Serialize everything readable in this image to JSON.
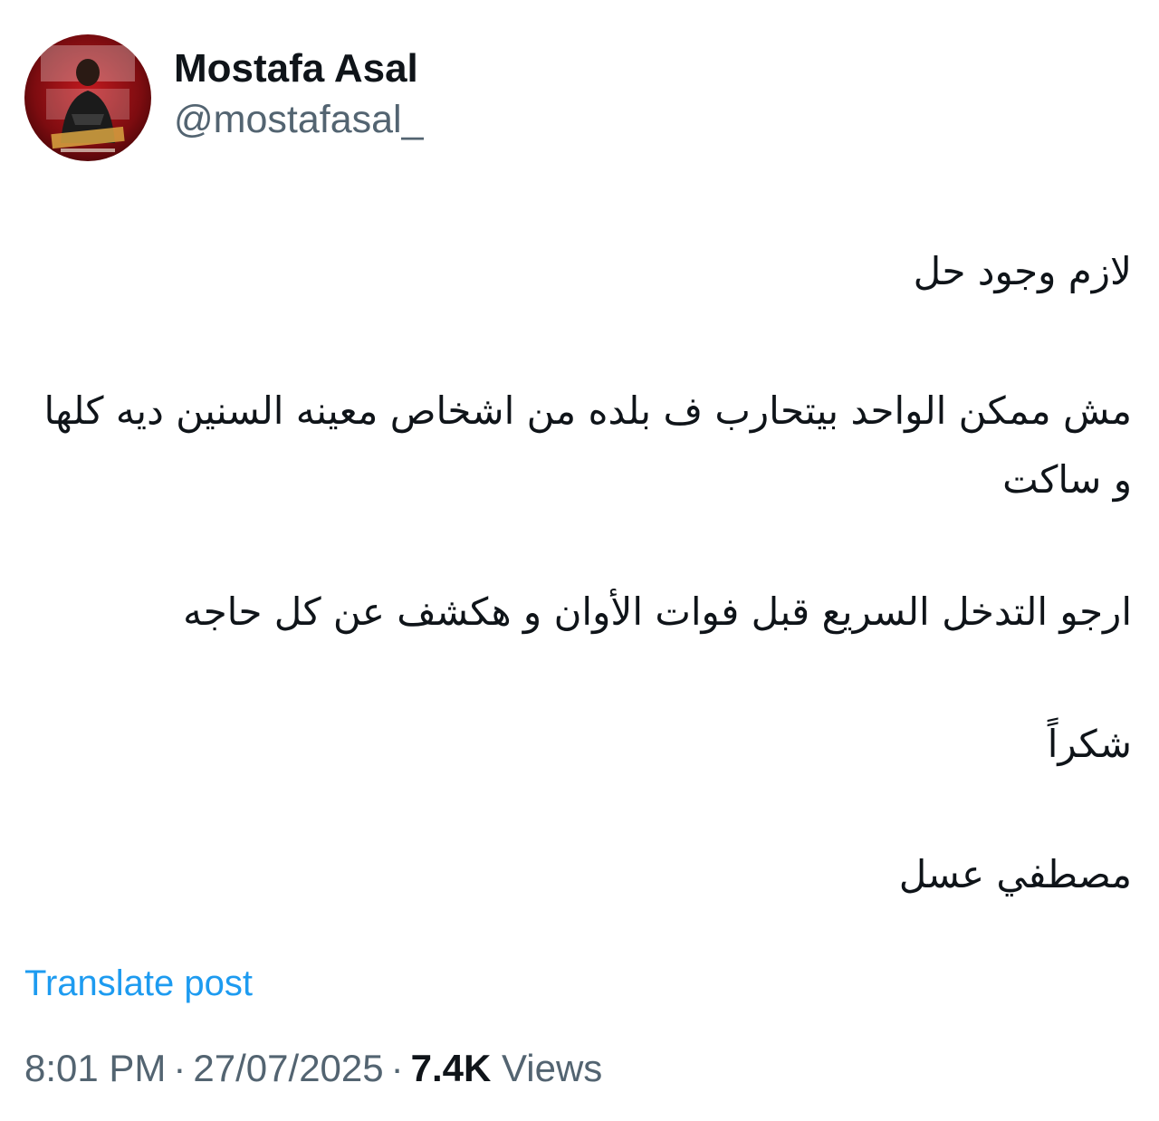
{
  "author": {
    "display_name": "Mostafa Asal",
    "handle": "@mostafasal_"
  },
  "post": {
    "paragraphs": [
      "لازم وجود حل",
      "مش ممكن الواحد بيتحارب ف بلده من اشخاص معينه السنين ديه كلها و ساكت",
      "ارجو التدخل السريع قبل فوات الأوان و هكشف عن كل حاجه",
      "شكراً",
      "مصطفي عسل"
    ],
    "translate_label": "Translate post"
  },
  "meta": {
    "time": "8:01 PM",
    "separator": "·",
    "date": "27/07/2025",
    "views_count": "7.4K",
    "views_label": "Views"
  },
  "colors": {
    "link": "#1d9bf0",
    "secondary_text": "#536471",
    "primary_text": "#0f1419",
    "avatar_bg": "#8b0e12"
  }
}
